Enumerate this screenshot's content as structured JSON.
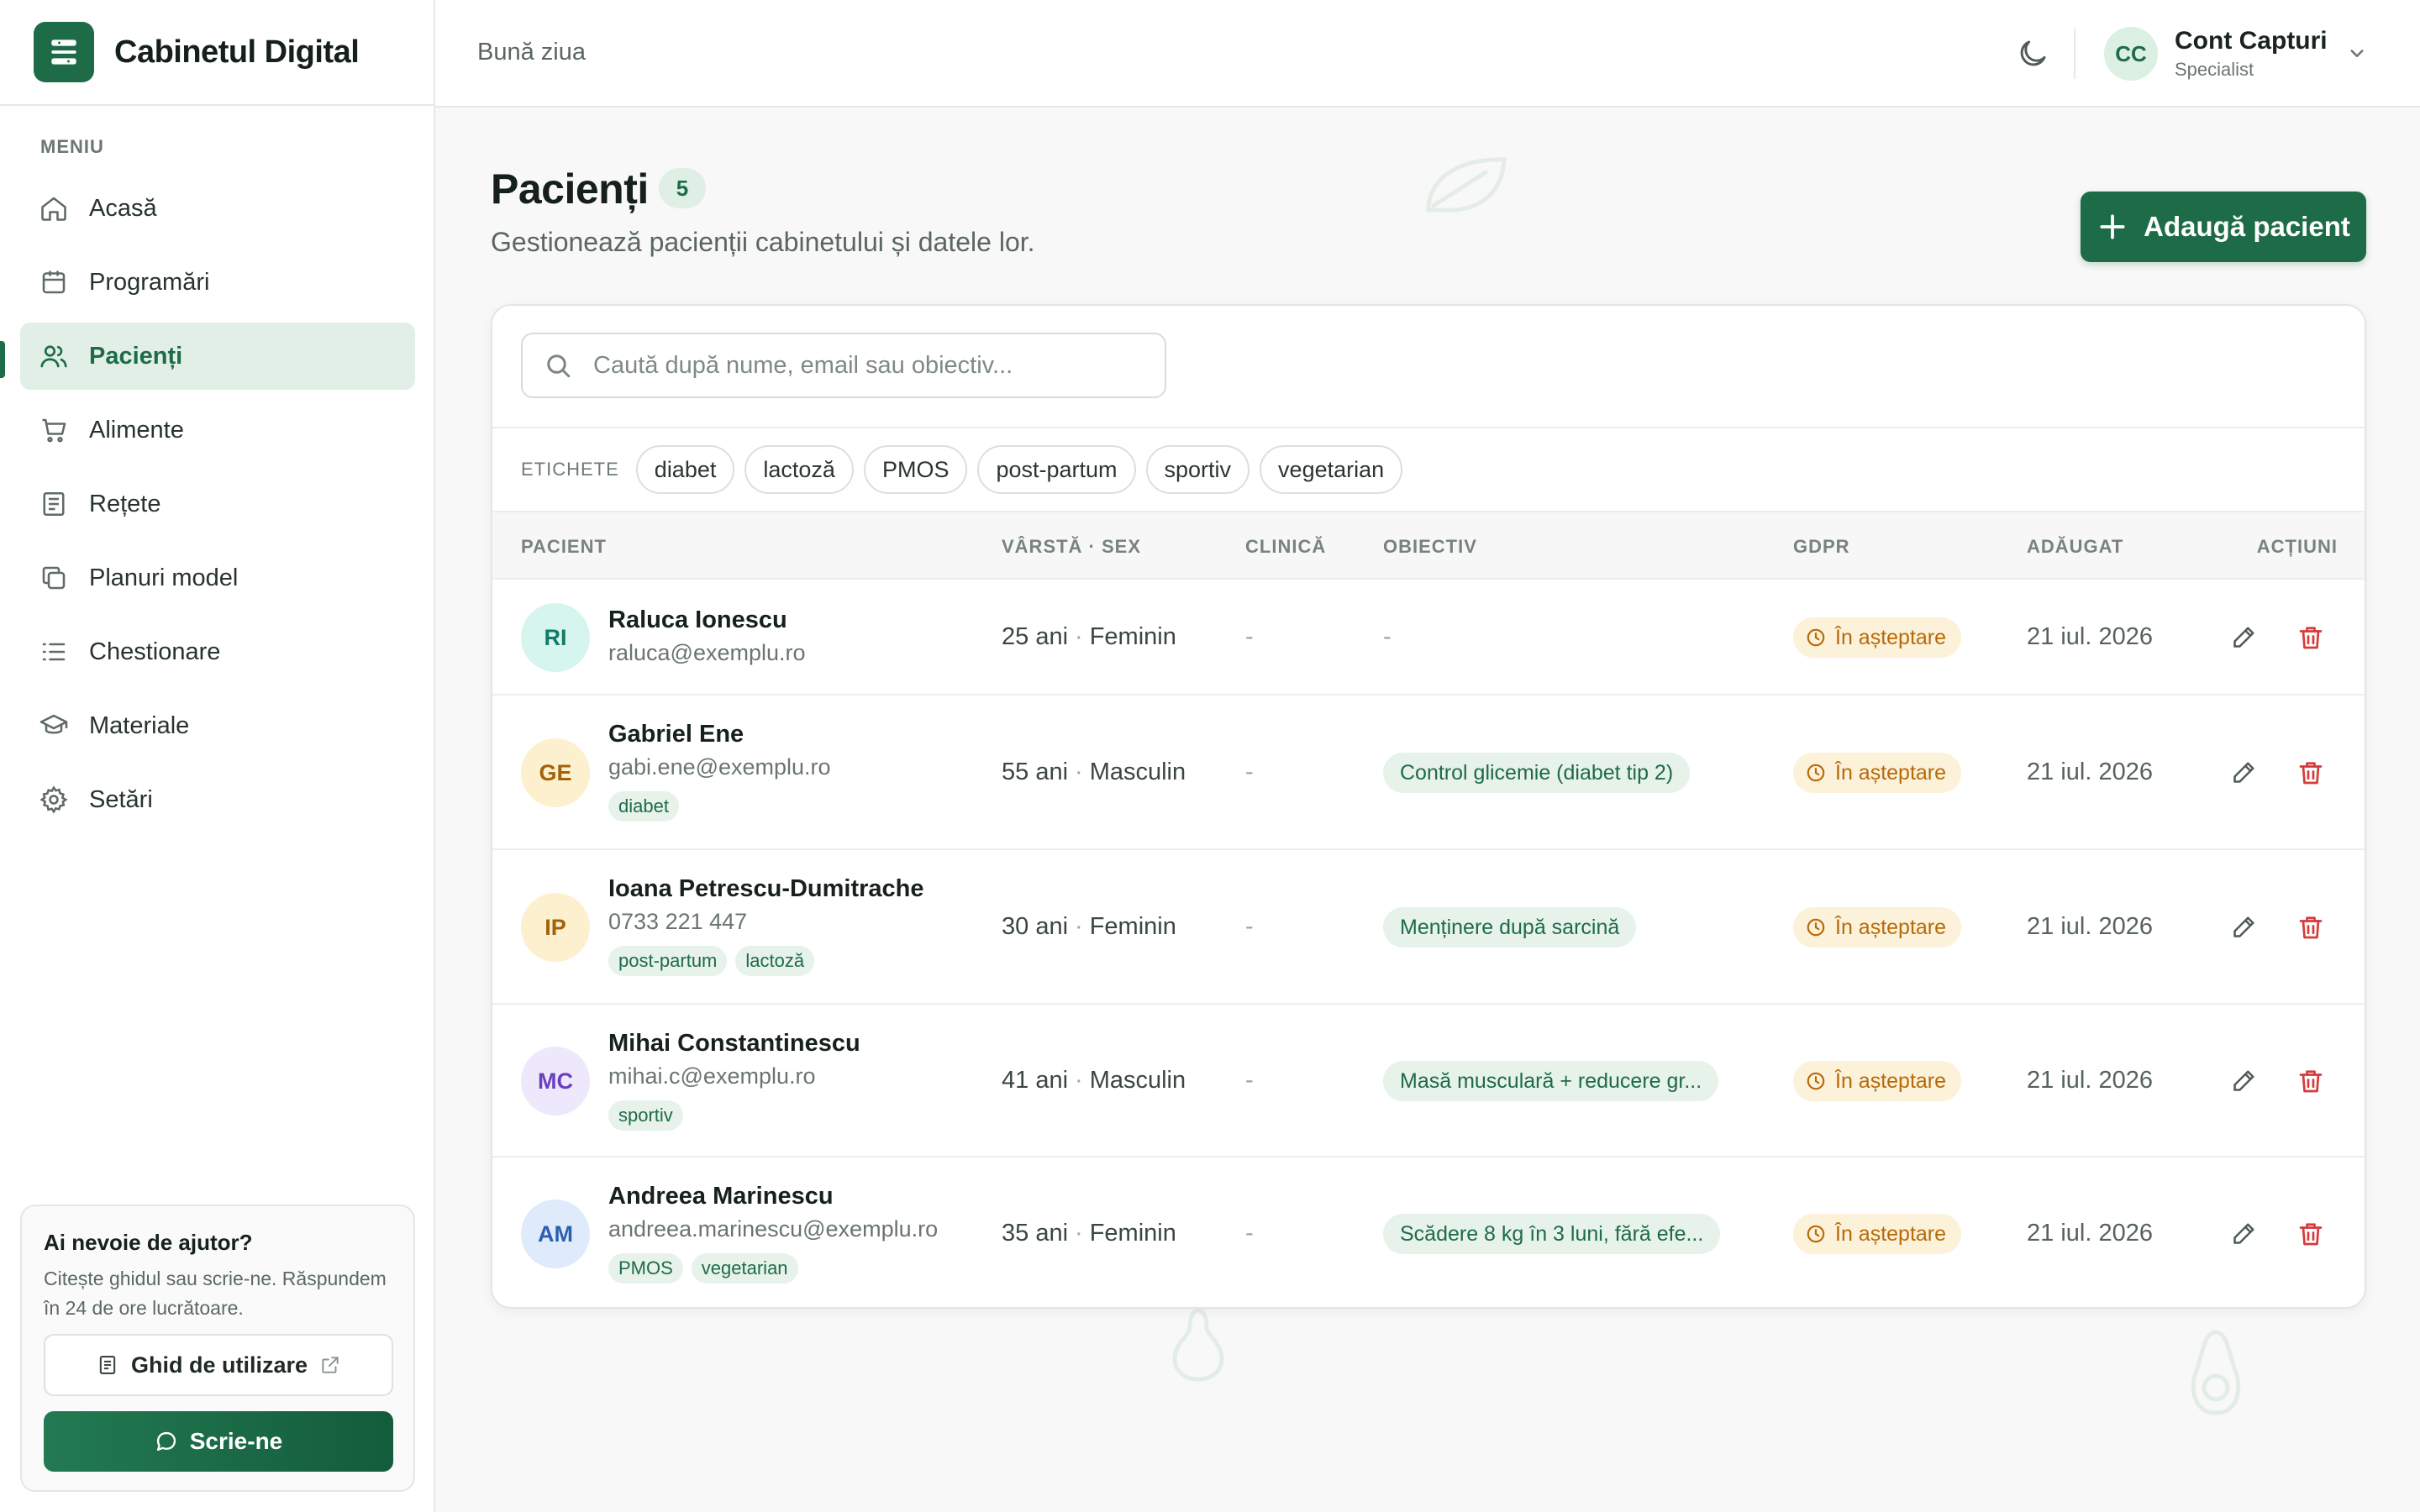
{
  "brand": {
    "name": "Cabinetul Digital"
  },
  "sidebar": {
    "menu_label": "MENIU",
    "items": [
      {
        "label": "Acasă",
        "icon": "home-icon"
      },
      {
        "label": "Programări",
        "icon": "calendar-icon"
      },
      {
        "label": "Pacienți",
        "icon": "users-icon",
        "active": true
      },
      {
        "label": "Alimente",
        "icon": "cart-icon"
      },
      {
        "label": "Rețete",
        "icon": "recipe-icon"
      },
      {
        "label": "Planuri model",
        "icon": "copy-icon"
      },
      {
        "label": "Chestionare",
        "icon": "list-icon"
      },
      {
        "label": "Materiale",
        "icon": "graduation-cap-icon"
      },
      {
        "label": "Setări",
        "icon": "gear-icon"
      }
    ],
    "help": {
      "title": "Ai nevoie de ajutor?",
      "text": "Citește ghidul sau scrie-ne. Răspundem în 24 de ore lucrătoare.",
      "guide_button": "Ghid de utilizare",
      "write_button": "Scrie-ne"
    }
  },
  "header": {
    "greeting": "Bună ziua",
    "account": {
      "initials": "CC",
      "name": "Cont Capturi",
      "role": "Specialist"
    }
  },
  "main": {
    "title": "Pacienți",
    "count": "5",
    "subtitle": "Gestionează pacienții cabinetului și datele lor.",
    "add_button": "Adaugă pacient",
    "search_placeholder": "Caută după nume, email sau obiectiv...",
    "tags_label": "ETICHETE",
    "tags": [
      "diabet",
      "lactoză",
      "PMOS",
      "post-partum",
      "sportiv",
      "vegetarian"
    ],
    "columns": {
      "patient": "PACIENT",
      "age_sex": "VÂRSTĂ · SEX",
      "clinic": "CLINICĂ",
      "goal": "OBIECTIV",
      "gdpr": "GDPR",
      "added": "ADĂUGAT",
      "actions": "ACȚIUNI"
    },
    "patients": [
      {
        "initials": "RI",
        "name": "Raluca Ionescu",
        "contact": "raluca@exemplu.ro",
        "tags": [],
        "age": "25 ani",
        "sex": "Feminin",
        "clinic": "-",
        "goal": "-",
        "gdpr": "În așteptare",
        "added": "21 iul. 2026",
        "avatar_bg": "#d6f5ee",
        "avatar_fg": "#137a66"
      },
      {
        "initials": "GE",
        "name": "Gabriel Ene",
        "contact": "gabi.ene@exemplu.ro",
        "tags": [
          "diabet"
        ],
        "age": "55 ani",
        "sex": "Masculin",
        "clinic": "-",
        "goal": "Control glicemie (diabet tip 2)",
        "gdpr": "În așteptare",
        "added": "21 iul. 2026",
        "avatar_bg": "#fdf0cf",
        "avatar_fg": "#a2620a"
      },
      {
        "initials": "IP",
        "name": "Ioana Petrescu-Dumitrache",
        "contact": "0733 221 447",
        "tags": [
          "post-partum",
          "lactoză"
        ],
        "age": "30 ani",
        "sex": "Feminin",
        "clinic": "-",
        "goal": "Menținere după sarcină",
        "gdpr": "În așteptare",
        "added": "21 iul. 2026",
        "avatar_bg": "#fdf0cf",
        "avatar_fg": "#a2620a"
      },
      {
        "initials": "MC",
        "name": "Mihai Constantinescu",
        "contact": "mihai.c@exemplu.ro",
        "tags": [
          "sportiv"
        ],
        "age": "41 ani",
        "sex": "Masculin",
        "clinic": "-",
        "goal": "Masă musculară + reducere gr...",
        "gdpr": "În așteptare",
        "added": "21 iul. 2026",
        "avatar_bg": "#ede8fb",
        "avatar_fg": "#6a3fbf"
      },
      {
        "initials": "AM",
        "name": "Andreea Marinescu",
        "contact": "andreea.marinescu@exemplu.ro",
        "tags": [
          "PMOS",
          "vegetarian"
        ],
        "age": "35 ani",
        "sex": "Feminin",
        "clinic": "-",
        "goal": "Scădere 8 kg în 3 luni, fără efe...",
        "gdpr": "În așteptare",
        "added": "21 iul. 2026",
        "avatar_bg": "#dfeafb",
        "avatar_fg": "#2d5fb0"
      }
    ]
  }
}
